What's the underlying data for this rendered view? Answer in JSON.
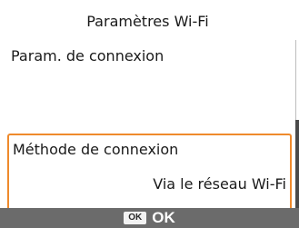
{
  "screen": {
    "title": "Paramètres Wi-Fi"
  },
  "menu": {
    "items": [
      {
        "label": "Param. de connexion"
      }
    ],
    "selected": {
      "label": "Méthode de connexion",
      "value": "Via le réseau Wi-Fi"
    }
  },
  "footer": {
    "key_label": "OK",
    "action_label": "OK"
  },
  "colors": {
    "selection_border": "#ef8a2c",
    "footer_background": "#6b6b6b"
  }
}
